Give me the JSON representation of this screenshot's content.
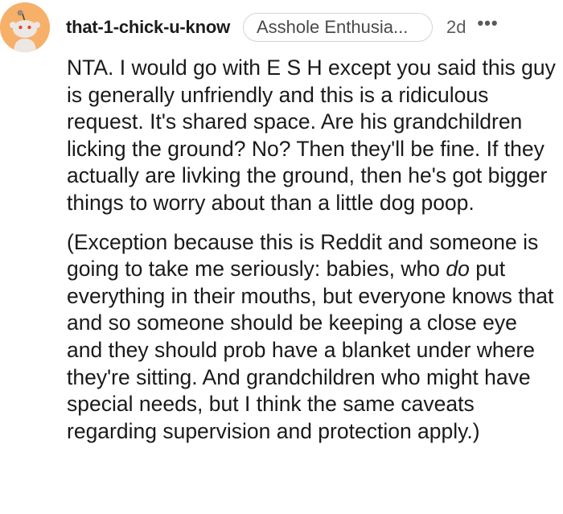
{
  "comment": {
    "username": "that-1-chick-u-know",
    "flair": "Asshole Enthusia...",
    "time": "2d",
    "more_icon": "more-options-icon",
    "avatar_icon": "reddit-snoo-avatar-icon",
    "avatar_color": "#F7B069",
    "paragraph_1": "NTA. I would go with E S H except you said this guy is generally unfriendly and this is a ridiculous request. It's shared space. Are his grandchildren licking the ground? No? Then they'll be fine. If they actually are livking the ground, then he's got bigger things to worry about than a little dog poop.",
    "paragraph_2_before": "(Exception because this is Reddit and someone is going to take me seriously: babies, who ",
    "paragraph_2_em": "do",
    "paragraph_2_after": " put everything in their mouths, but everyone knows that and so someone should be keeping a close eye and they should prob have a blanket under where they're sitting. And grandchildren who might have special needs, but I think the same caveats regarding supervision and protection apply.)"
  }
}
